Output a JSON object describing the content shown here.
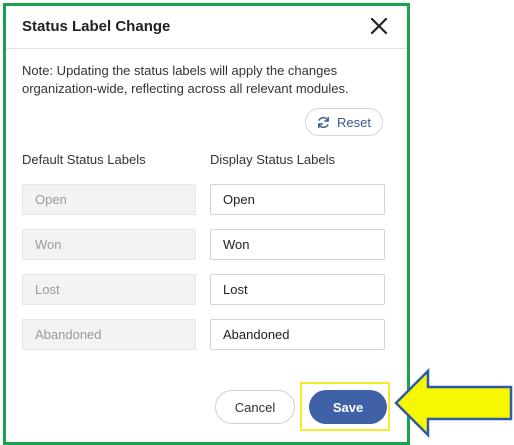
{
  "dialog": {
    "title": "Status Label Change",
    "note": "Note: Updating the status labels will apply the changes organization-wide, reflecting across all relevant modules.",
    "reset_label": "Reset",
    "col_default": "Default Status Labels",
    "col_display": "Display Status Labels",
    "rows": [
      {
        "default": "Open",
        "display": "Open"
      },
      {
        "default": "Won",
        "display": "Won"
      },
      {
        "default": "Lost",
        "display": "Lost"
      },
      {
        "default": "Abandoned",
        "display": "Abandoned"
      }
    ],
    "cancel_label": "Cancel",
    "save_label": "Save"
  },
  "colors": {
    "frame": "#1aa34a",
    "save": "#3f61a8",
    "highlight": "#f7ea2a",
    "arrow_fill": "#f7f700",
    "arrow_stroke": "#2f5aa8"
  },
  "icons": [
    "close-icon",
    "refresh-icon",
    "arrow-pointer-icon"
  ]
}
